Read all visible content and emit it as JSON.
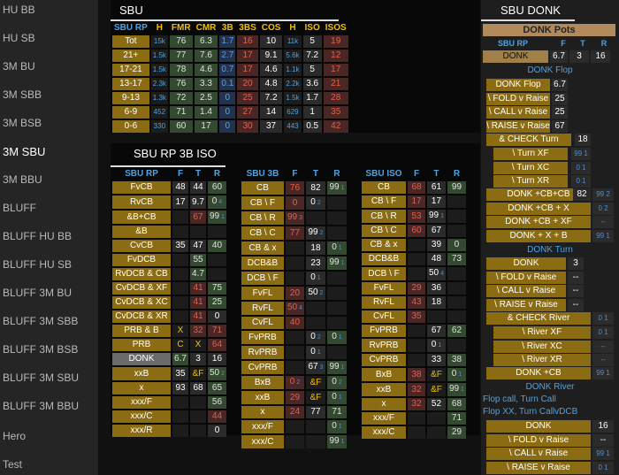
{
  "nav": [
    "HU BB",
    "HU SB",
    "3M BU",
    "3M SBB",
    "3M BSB",
    "3M SBU",
    "3M BBU",
    "BLUFF",
    "BLUFF HU BB",
    "BLUFF HU SB",
    "BLUFF 3M BU",
    "BLUFF 3M SBB",
    "BLUFF 3M BSB",
    "BLUFF 3M SBU",
    "BLUFF 3M BBU",
    "Hero",
    "Test"
  ],
  "sbu": {
    "title": "SBU",
    "headers": [
      "SBU RP",
      "H",
      "FMR",
      "CMR",
      "3B",
      "3BS",
      "COS",
      "H",
      "ISO",
      "ISOS"
    ],
    "rows": [
      [
        "Tot",
        "15k",
        "76",
        "6.3",
        "1.7",
        "16",
        "10",
        "11k",
        "5",
        "19"
      ],
      [
        "21+",
        "1.5k",
        "77",
        "7.6",
        "2.7",
        "17",
        "9.1",
        "5.6k",
        "7.2",
        "12"
      ],
      [
        "17-21",
        "1.5k",
        "78",
        "4.6",
        "0.7",
        "17",
        "4.6",
        "1.1k",
        "5",
        "17"
      ],
      [
        "13-17",
        "2.3k",
        "76",
        "3.3",
        "0.1",
        "20",
        "4.8",
        "2.2k",
        "3.6",
        "21"
      ],
      [
        "9-13",
        "1.3k",
        "72",
        "2.5",
        "0",
        "25",
        "7.2",
        "1.5k",
        "1.7",
        "28"
      ],
      [
        "6-9",
        "452",
        "71",
        "1.4",
        "0",
        "27",
        "14",
        "629",
        "1",
        "35"
      ],
      [
        "0-6",
        "330",
        "60",
        "17",
        "0",
        "30",
        "37",
        "443",
        "0.5",
        "42"
      ]
    ]
  },
  "rp3b": {
    "title": "SBU RP 3B ISO",
    "t1": {
      "headers": [
        "SBU RP",
        "F",
        "T",
        "R"
      ],
      "rows": [
        [
          "FvCB",
          "48",
          "44",
          "60"
        ],
        [
          "RvCB",
          "17",
          "9.7",
          "0 4"
        ],
        [
          "&B+CB",
          "",
          "67",
          "99 1"
        ],
        [
          "&B",
          "",
          "",
          ""
        ],
        [
          "CvCB",
          "35",
          "47",
          "40"
        ],
        [
          "FvDCB",
          "",
          "55",
          ""
        ],
        [
          "RvDCB & CB",
          "",
          "4.7",
          ""
        ],
        [
          "CvDCB & XF",
          "",
          "41",
          "75"
        ],
        [
          "CvDCB & XC",
          "",
          "41",
          "25"
        ],
        [
          "CvDCB & XR",
          "",
          "41",
          "0"
        ],
        [
          "PRB & B",
          "X",
          "32",
          "71"
        ],
        [
          "PRB",
          "C",
          "X",
          "64"
        ],
        [
          "DONK",
          "6.7",
          "3",
          "16"
        ],
        [
          "xxB",
          "35",
          "&F",
          "50 2"
        ],
        [
          "x",
          "93",
          "68",
          "65"
        ],
        [
          "xxx/F",
          "",
          "",
          "56"
        ],
        [
          "xxx/C",
          "",
          "",
          "44"
        ],
        [
          "xxx/R",
          "",
          "",
          "0"
        ]
      ]
    },
    "t2": {
      "headers": [
        "SBU 3B",
        "F",
        "T",
        "R"
      ],
      "rows": [
        [
          "CB",
          "76",
          "82",
          "99 1"
        ],
        [
          "CB \\ F",
          "0",
          "0 2",
          ""
        ],
        [
          "CB \\ R",
          "99 3",
          "",
          ""
        ],
        [
          "CB \\ C",
          "77",
          "99 2",
          ""
        ],
        [
          "CB & x",
          "",
          "18",
          "0 1"
        ],
        [
          "DCB&B",
          "",
          "23",
          "99 1"
        ],
        [
          "DCB \\ F",
          "",
          "0 1",
          ""
        ],
        [
          "FvFL",
          "20",
          "50 2",
          ""
        ],
        [
          "RvFL",
          "50 4",
          "",
          ""
        ],
        [
          "CvFL",
          "40",
          "",
          ""
        ],
        [
          "FvPRB",
          "",
          "0 2",
          "0 1"
        ],
        [
          "RvPRB",
          "",
          "0 1",
          ""
        ],
        [
          "CvPRB",
          "",
          "67 3",
          "99 1"
        ],
        [
          "BxB",
          "0 2",
          "&F",
          "0 2"
        ],
        [
          "xxB",
          "29",
          "&F",
          "0 1"
        ],
        [
          "x",
          "24",
          "77",
          "71"
        ],
        [
          "xxx/F",
          "",
          "",
          "0 1"
        ],
        [
          "xxx/C",
          "",
          "",
          "99 1"
        ]
      ]
    },
    "t3": {
      "headers": [
        "SBU ISO",
        "F",
        "T",
        "R"
      ],
      "rows": [
        [
          "CB",
          "68",
          "61",
          "99"
        ],
        [
          "CB \\ F",
          "17",
          "17",
          ""
        ],
        [
          "CB \\ R",
          "53",
          "99 1",
          ""
        ],
        [
          "CB \\ C",
          "60",
          "67",
          ""
        ],
        [
          "CB & x",
          "",
          "39",
          "0"
        ],
        [
          "DCB&B",
          "",
          "48",
          "73"
        ],
        [
          "DCB \\ F",
          "",
          "50 4",
          ""
        ],
        [
          "FvFL",
          "29",
          "36",
          ""
        ],
        [
          "RvFL",
          "43",
          "18",
          ""
        ],
        [
          "CvFL",
          "35",
          "",
          ""
        ],
        [
          "FvPRB",
          "",
          "67",
          "62"
        ],
        [
          "RvPRB",
          "",
          "0 1",
          ""
        ],
        [
          "CvPRB",
          "",
          "33",
          "38"
        ],
        [
          "BxB",
          "38",
          "&F",
          "0 1"
        ],
        [
          "xxB",
          "32",
          "&F",
          "99 1"
        ],
        [
          "x",
          "32",
          "52",
          "68"
        ],
        [
          "xxx/F",
          "",
          "",
          "71"
        ],
        [
          "xxx/C",
          "",
          "",
          "29"
        ]
      ]
    }
  },
  "donk": {
    "title": "SBU DONK",
    "pots_title": "DONK Pots",
    "head": [
      "SBU RP",
      "F",
      "T",
      "R"
    ],
    "donk_row": [
      "DONK",
      "6.7",
      "3",
      "16"
    ],
    "flop_title": "DONK Flop",
    "flop": [
      [
        "DONK Flop",
        "6.7"
      ],
      [
        "\\ FOLD v Raise",
        "25"
      ],
      [
        "\\ CALL v Raise",
        "25"
      ],
      [
        "\\ RAISE v Raise",
        "67"
      ]
    ],
    "check_turn": [
      "& CHECK Turn",
      "18"
    ],
    "turn_x": [
      [
        "\\ Turn XF",
        "99 1"
      ],
      [
        "\\ Turn XC",
        "0 1"
      ],
      [
        "\\ Turn XR",
        "0 1"
      ]
    ],
    "cb_rows": [
      [
        "DONK +CB+CB",
        "82",
        "99 2"
      ],
      [
        "DONK +CB + X",
        "0 2"
      ],
      [
        "DONK +CB + XF",
        "--"
      ],
      [
        "DONK + X + B",
        "99 1"
      ]
    ],
    "turn_title": "DONK Turn",
    "turn": [
      [
        "DONK",
        "3"
      ],
      [
        "\\ FOLD v Raise",
        "--"
      ],
      [
        "\\ CALL v Raise",
        "--"
      ],
      [
        "\\ RAISE v Raise",
        "--"
      ]
    ],
    "check_river": [
      "& CHECK River",
      "0 1"
    ],
    "river_x": [
      [
        "\\ River XF",
        "0 1"
      ],
      [
        "\\ River XC",
        "--"
      ],
      [
        "\\ River XR",
        "--"
      ]
    ],
    "donk_cb": [
      "DONK +CB",
      "99 1"
    ],
    "river_title": "DONK River",
    "notes": [
      "Flop call, Turn Call",
      "Flop XX, Turn CallvDCB"
    ],
    "river": [
      [
        "DONK",
        "16"
      ],
      [
        "\\ FOLD v Raise",
        "--"
      ],
      [
        "\\ CALL v Raise",
        "99 1"
      ],
      [
        "\\ RAISE v Raise",
        "0 1"
      ]
    ]
  }
}
